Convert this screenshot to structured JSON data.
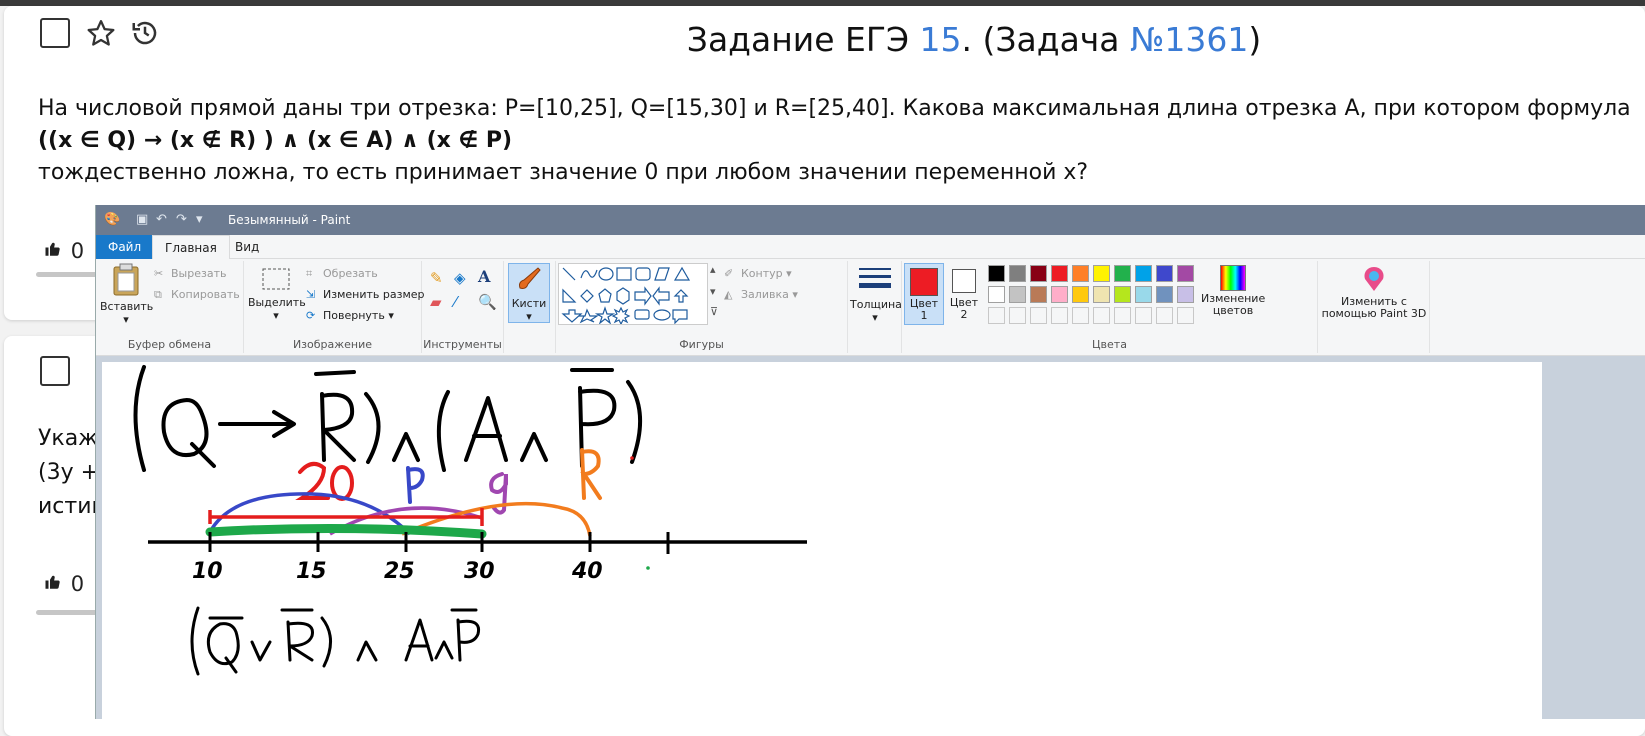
{
  "card1": {
    "title_prefix": "Задание ЕГЭ ",
    "title_num": "15",
    "title_mid": ". (Задача ",
    "title_task": "№1361",
    "title_suffix": ")",
    "line1": "На числовой прямой даны три отрезка: P=[10,25], Q=[15,30] и R=[25,40]. Какова максимальная длина отрезка А, при котором формула",
    "formula": "((x ∈ Q) → (x ∉ R) ) ∧ (x ∈ A) ∧ (x ∉ P)",
    "line3": "тождественно ложна, то есть принимает значение 0 при любом значении переменной х?",
    "likes": "0"
  },
  "card2": {
    "partial1": "Укаж",
    "partial2": "(3у + ",
    "partial3": "истин",
    "likes": "0"
  },
  "paint": {
    "title": "Безымянный - Paint",
    "tabs": {
      "file": "Файл",
      "home": "Главная",
      "view": "Вид"
    },
    "clipboard": {
      "label": "Буфер обмена",
      "paste": "Вставить",
      "cut": "Вырезать",
      "copy": "Копировать"
    },
    "image": {
      "label": "Изображение",
      "select": "Выделить",
      "crop": "Обрезать",
      "resize": "Изменить размер",
      "rotate": "Повернуть"
    },
    "tools": {
      "label": "Инструменты"
    },
    "brushes": "Кисти",
    "shapes": {
      "label": "Фигуры",
      "outline": "Контур",
      "fill": "Заливка"
    },
    "size": "Толщина",
    "color1": "Цвет\n1",
    "color2": "Цвет\n2",
    "colors": {
      "label": "Цвета",
      "edit": "Изменение цветов",
      "paint3d": "Изменить с помощью Paint 3D"
    },
    "palette_row1": [
      "#000000",
      "#7f7f7f",
      "#880015",
      "#ed1c24",
      "#ff7f27",
      "#fff200",
      "#22b14c",
      "#00a2e8",
      "#3f48cc",
      "#a349a4"
    ],
    "palette_row2": [
      "#ffffff",
      "#c3c3c3",
      "#b97a57",
      "#ffaec9",
      "#ffc90e",
      "#efe4b0",
      "#b5e61d",
      "#99d9ea",
      "#7092be",
      "#c8bfe7"
    ],
    "active_color": "#ed1c24"
  },
  "drawing": {
    "label_20": "20",
    "label_P": "P",
    "label_Q": "Q",
    "label_R": "R",
    "ticks": [
      "10",
      "15",
      "25",
      "30",
      "40"
    ]
  }
}
